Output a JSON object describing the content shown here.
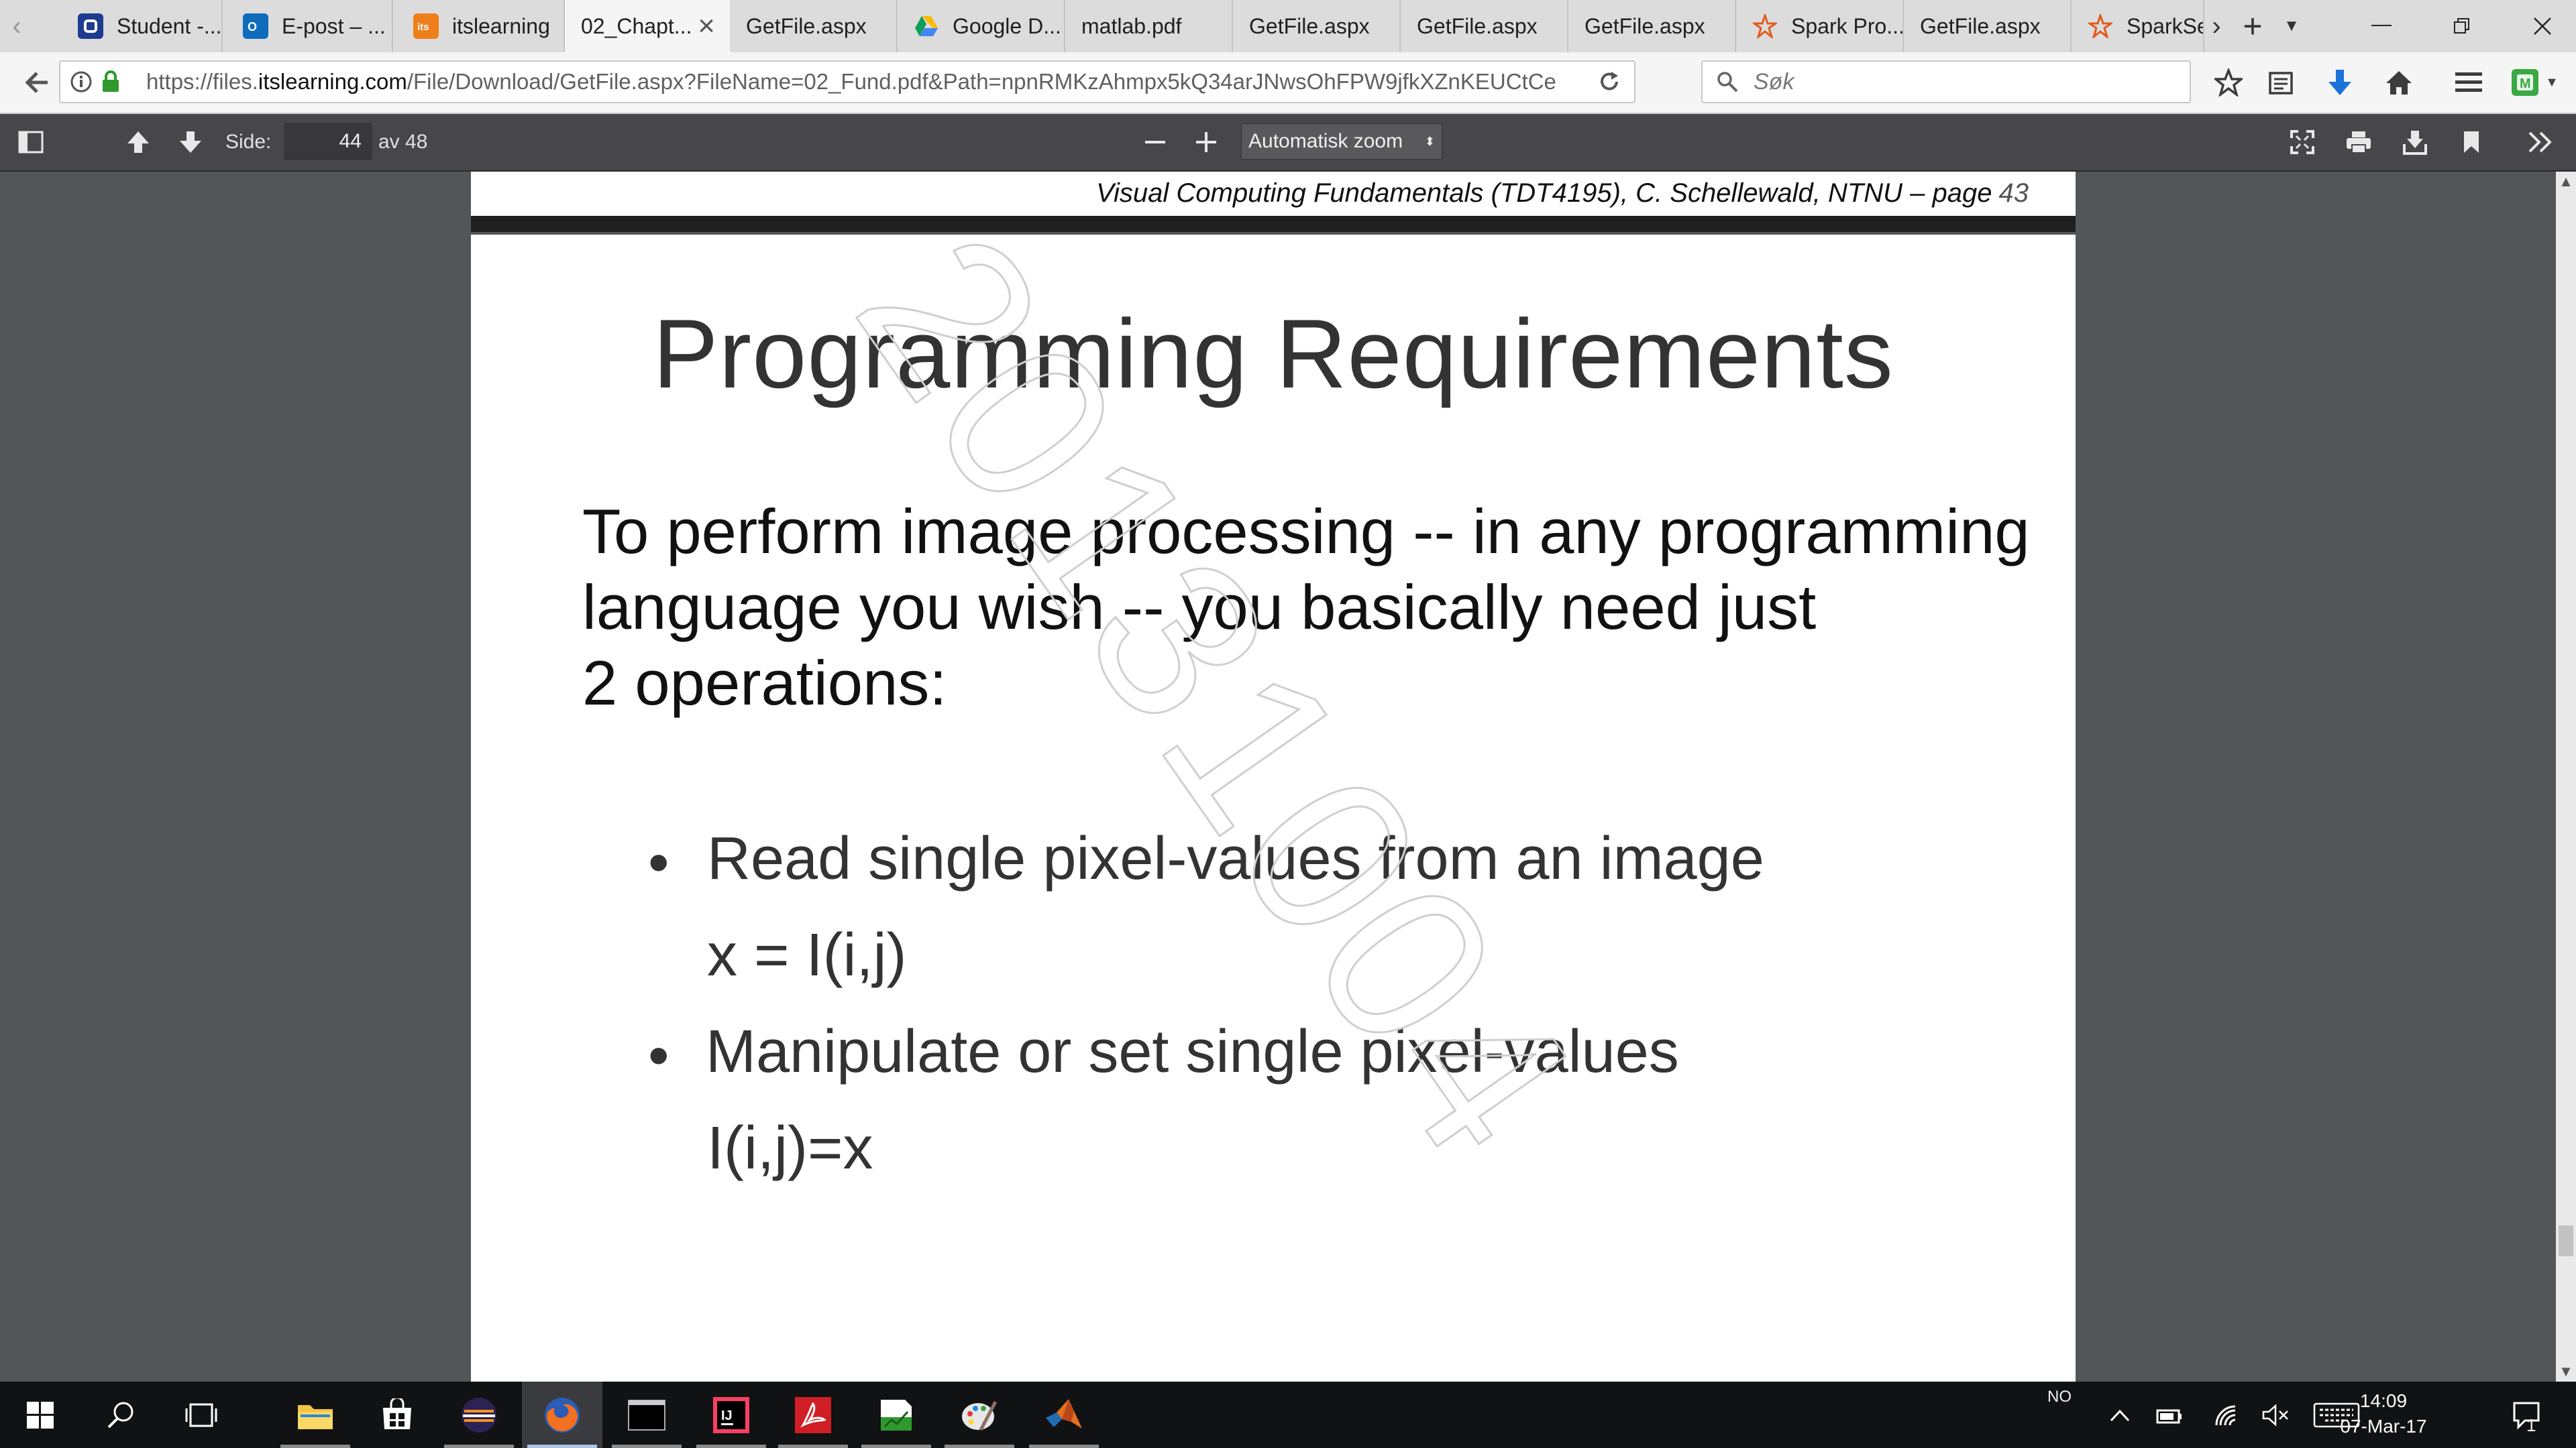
{
  "browser": {
    "tabs": [
      {
        "label": "Student -...",
        "icon": "student-portal-icon",
        "active": false
      },
      {
        "label": "E-post – ...",
        "icon": "outlook-icon",
        "active": false
      },
      {
        "label": "itslearning",
        "icon": "itslearning-icon",
        "active": false
      },
      {
        "label": "02_Chapt...",
        "icon": "none",
        "active": true
      },
      {
        "label": "GetFile.aspx",
        "icon": "none",
        "active": false
      },
      {
        "label": "Google D...",
        "icon": "google-drive-icon",
        "active": false
      },
      {
        "label": "matlab.pdf",
        "icon": "none",
        "active": false
      },
      {
        "label": "GetFile.aspx",
        "icon": "none",
        "active": false
      },
      {
        "label": "GetFile.aspx",
        "icon": "none",
        "active": false
      },
      {
        "label": "GetFile.aspx",
        "icon": "none",
        "active": false
      },
      {
        "label": "Spark Pro...",
        "icon": "spark-icon",
        "active": false
      },
      {
        "label": "GetFile.aspx",
        "icon": "none",
        "active": false
      },
      {
        "label": "SparkSe",
        "icon": "spark-icon",
        "active": false
      }
    ],
    "url_prefix": "https://files.",
    "url_host": "itslearning.com",
    "url_rest": "/File/Download/GetFile.aspx?FileName=02_Fund.pdf&Path=npnRMKzAhmpx5kQ34arJNwsOhFPW9jfkXZnKEUCtCe",
    "search_placeholder": "Søk"
  },
  "pdf_toolbar": {
    "page_label": "Side:",
    "page_number": "44",
    "page_total": "av 48",
    "zoom": "Automatisk zoom"
  },
  "document": {
    "previous_footer": "Visual Computing Fundamentals (TDT4195), C. Schellewald, NTNU  – page",
    "previous_page_num": "43",
    "title": "Programming Requirements",
    "intro_lines": [
      "To perform image processing -- in any programming",
      "language you wish -- you basically need just",
      "2 operations:"
    ],
    "bullets": [
      {
        "text": "Read single pixel-values from an image",
        "formula": "x = I(i,j)"
      },
      {
        "text": "Manipulate or set single pixel-values",
        "formula": "I(i,j)=x"
      }
    ],
    "watermark": "20131004"
  },
  "taskbar": {
    "language": "NO",
    "time": "14:09",
    "date": "07-Mar-17",
    "notification_count": "1"
  },
  "colors": {
    "pdf_toolbar": "#474749",
    "viewer_bg": "#525659",
    "taskbar": "#111214",
    "download_arrow": "#1a73d9"
  }
}
